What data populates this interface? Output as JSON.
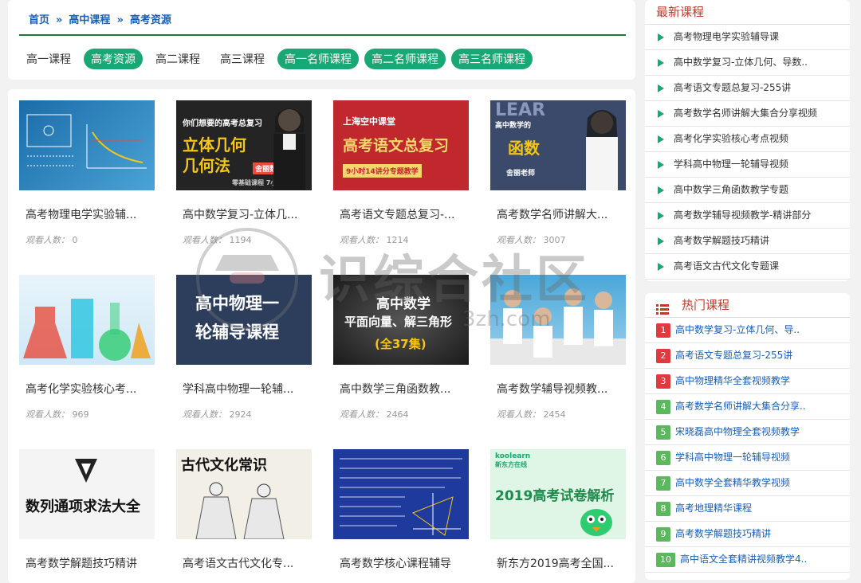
{
  "breadcrumb": {
    "home": "首页",
    "level1": "高中课程",
    "level2": "高考资源",
    "sep": "»"
  },
  "tabs": [
    {
      "label": "高一课程",
      "active": false
    },
    {
      "label": "高考资源",
      "active": true
    },
    {
      "label": "高二课程",
      "active": false
    },
    {
      "label": "高三课程",
      "active": false
    },
    {
      "label": "高一名师课程",
      "active": true
    },
    {
      "label": "高二名师课程",
      "active": true
    },
    {
      "label": "高三名师课程",
      "active": true
    }
  ],
  "view_label": "观看人数：",
  "cards": [
    {
      "title": "高考物理电学实验辅...",
      "views": "0"
    },
    {
      "title": "高中数学复习-立体几...",
      "views": "1194",
      "thumb_text": [
        "你们想要的高考总复习",
        "立体几何",
        "几何法",
        "舍丽数学",
        "零基础课程 7小时搞定"
      ]
    },
    {
      "title": "高考语文专题总复习-...",
      "views": "1214",
      "thumb_text": [
        "上海空中课堂",
        "高考语文总复习",
        "9小时14讲分专题教学"
      ]
    },
    {
      "title": "高考数学名师讲解大...",
      "views": "3007",
      "thumb_text": [
        "LEAR",
        "高中数学的",
        "函数",
        "舍丽老师"
      ]
    },
    {
      "title": "高考化学实验核心考...",
      "views": "969"
    },
    {
      "title": "学科高中物理一轮辅...",
      "views": "2924",
      "thumb_text": [
        "高中物理一",
        "轮辅导课程"
      ]
    },
    {
      "title": "高中数学三角函数教...",
      "views": "2464",
      "thumb_text": [
        "高中数学",
        "平面向量、解三角形",
        "(全37集)"
      ]
    },
    {
      "title": "高考数学辅导视频教...",
      "views": "2454"
    },
    {
      "title": "高考数学解题技巧精讲",
      "views": "",
      "thumb_text": [
        "数列通项求法大全"
      ]
    },
    {
      "title": "高考语文古代文化专...",
      "views": "",
      "thumb_text": [
        "古代文化常识"
      ]
    },
    {
      "title": "高考数学核心课程辅导",
      "views": ""
    },
    {
      "title": "新东方2019高考全国...",
      "views": "",
      "thumb_text": [
        "koolearn",
        "新东方在线",
        "2019高考试卷解析"
      ]
    }
  ],
  "latest": {
    "title": "最新课程",
    "items": [
      "高考物理电学实验辅导课",
      "高中数学复习-立体几何、导数..",
      "高考语文专题总复习-255讲",
      "高考数学名师讲解大集合分享视频",
      "高考化学实验核心考点视频",
      "学科高中物理一轮辅导视频",
      "高中数学三角函数教学专题",
      "高考数学辅导视频教学-精讲部分",
      "高考数学解题技巧精讲",
      "高考语文古代文化专题课"
    ]
  },
  "hot": {
    "title": "热门课程",
    "items": [
      {
        "n": "1",
        "label": "高中数学复习-立体几何、导..",
        "color": "#e0393e"
      },
      {
        "n": "2",
        "label": "高考语文专题总复习-255讲",
        "color": "#e0393e"
      },
      {
        "n": "3",
        "label": "高中物理精华全套视频教学",
        "color": "#e0393e"
      },
      {
        "n": "4",
        "label": "高考数学名师讲解大集合分享..",
        "color": "#5cb85c"
      },
      {
        "n": "5",
        "label": "宋晓磊高中物理全套视频教学",
        "color": "#5cb85c"
      },
      {
        "n": "6",
        "label": "学科高中物理一轮辅导视频",
        "color": "#5cb85c"
      },
      {
        "n": "7",
        "label": "高中数学全套精华教学视频",
        "color": "#5cb85c"
      },
      {
        "n": "8",
        "label": "高考地理精华课程",
        "color": "#5cb85c"
      },
      {
        "n": "9",
        "label": "高考数学解题技巧精讲",
        "color": "#5cb85c"
      },
      {
        "n": "10",
        "label": "高中语文全套精讲视频教学4..",
        "color": "#5cb85c"
      }
    ]
  },
  "watermark": {
    "text": "识综合社区",
    "sub": "3zh.com"
  },
  "colors": {
    "accent": "#19a873",
    "link": "#1a5fb4",
    "header": "#c0392b",
    "rule": "#1f7a34"
  }
}
